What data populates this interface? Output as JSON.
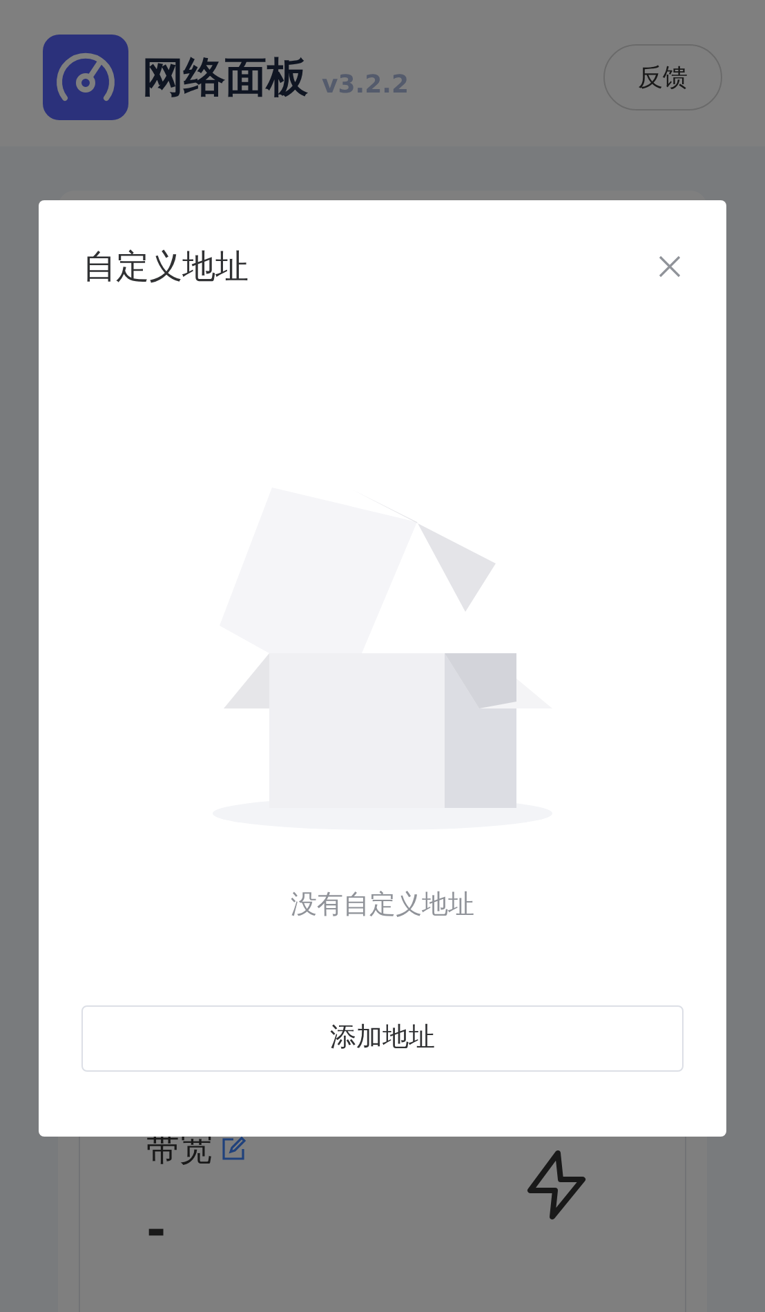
{
  "header": {
    "app_name": "网络面板",
    "version": "v3.2.2",
    "feedback_button": "反馈"
  },
  "bandwidth_card": {
    "label": "带宽",
    "value": "-"
  },
  "dialog": {
    "title": "自定义地址",
    "empty_text": "没有自定义地址",
    "add_button": "添加地址"
  }
}
